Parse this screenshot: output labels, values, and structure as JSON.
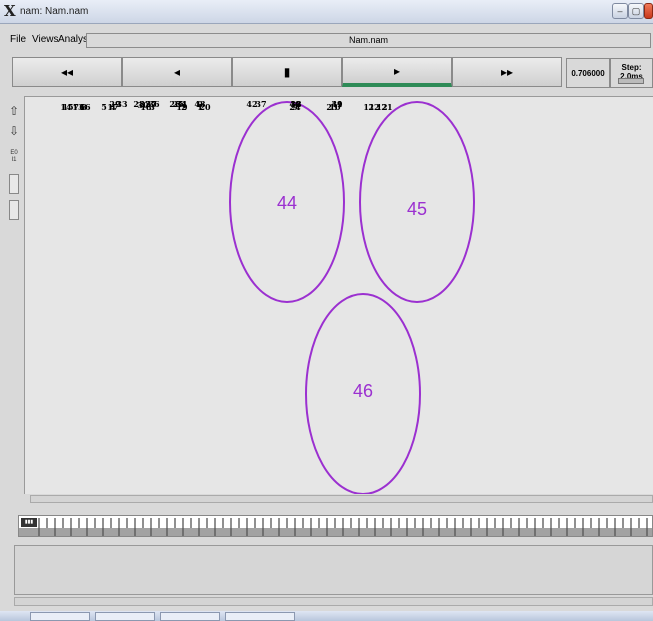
{
  "window": {
    "title": "nam: Nam.nam"
  },
  "menu": {
    "items": [
      "File",
      "Views",
      "Analysis"
    ],
    "filename": "Nam.nam"
  },
  "controls": {
    "rewind_fast": "◂◂",
    "rewind": "◂",
    "stop": "▮",
    "play": "▸",
    "forward_fast": "▸▸",
    "time": "0.706000",
    "step": "Step: 2.0ms"
  },
  "clusters": [
    {
      "label": "44",
      "color": "#9b30d0"
    },
    {
      "label": "45",
      "color": "#9b30d0"
    },
    {
      "label": "46",
      "color": "#9b30d0"
    }
  ],
  "nodes": [
    "1",
    "2",
    "3",
    "4",
    "13",
    "14",
    "15",
    "16",
    "25",
    "26",
    "27",
    "28",
    "29",
    "30",
    "5",
    "6",
    "7",
    "8",
    "17",
    "18",
    "19",
    "20",
    "31",
    "32",
    "33",
    "34",
    "35",
    "36",
    "9",
    "10",
    "11",
    "12",
    "21",
    "22",
    "23",
    "24",
    "37",
    "38",
    "39",
    "40",
    "41",
    "42",
    "43",
    "0"
  ],
  "timeline": {
    "thumb_label": "▮▮▮"
  }
}
